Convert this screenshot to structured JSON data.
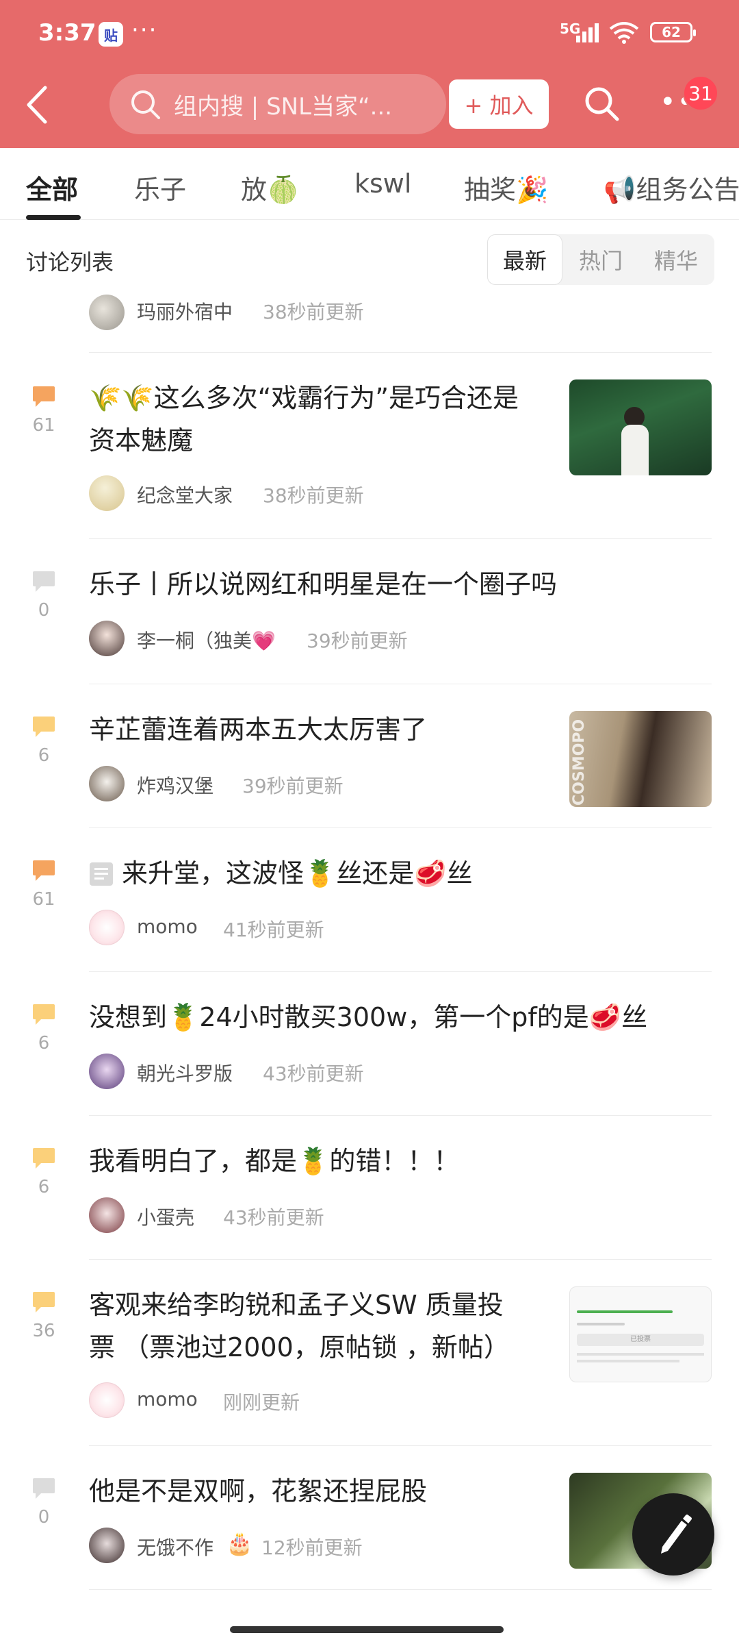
{
  "status_bar": {
    "time": "3:37",
    "app_badge": "贴",
    "more": "···",
    "network": "5G",
    "battery": "62"
  },
  "header": {
    "search_placeholder": "组内搜 | SNL当家“...",
    "join_label": "+ 加入",
    "notification_count": "31",
    "accent_color": "#e66a6a"
  },
  "tabs": [
    {
      "label": "全部"
    },
    {
      "label": "乐子"
    },
    {
      "label": "放🍈"
    },
    {
      "label": "kswl"
    },
    {
      "label": "抽奖🎉"
    },
    {
      "label": "📢组务公告"
    }
  ],
  "list": {
    "title": "讨论列表",
    "sort": [
      {
        "label": "最新"
      },
      {
        "label": "热门"
      },
      {
        "label": "精华"
      }
    ]
  },
  "partial_post": {
    "author": "玛丽外宿中",
    "updated": "38秒前更新"
  },
  "posts": [
    {
      "comments": "61",
      "title_line1": "🌾🌾这么多次“戏霸行为”是巧合还是",
      "title_line2": "资本魅魔",
      "author": "纪念堂大家",
      "updated": "38秒前更新",
      "has_thumb": true
    },
    {
      "comments": "0",
      "title_line1": "乐子丨所以说网红和明星是在一个圈子吗",
      "title_line2": "",
      "author": "李一桐（独美💗",
      "updated": "39秒前更新",
      "has_thumb": false
    },
    {
      "comments": "6",
      "title_line1": "辛芷蕾连着两本五大太厉害了",
      "title_line2": "",
      "author": "炸鸡汉堡",
      "updated": "39秒前更新",
      "has_thumb": true,
      "thumb_text": "COSMOPO"
    },
    {
      "comments": "61",
      "title_line1": "来升堂，这波怪🍍丝还是🥩丝",
      "title_line2": "",
      "author": "momo",
      "updated": "41秒前更新",
      "has_thumb": false
    },
    {
      "comments": "6",
      "title_line1": "没想到🍍24小时散买300w，第一个pf的是🥩丝",
      "title_line2": "",
      "author": "朝光斗罗版",
      "updated": "43秒前更新",
      "has_thumb": false
    },
    {
      "comments": "6",
      "title_line1": "我看明白了，都是🍍的错！！！",
      "title_line2": "",
      "author": "小蛋壳",
      "updated": "43秒前更新",
      "has_thumb": false
    },
    {
      "comments": "36",
      "title_line1": "客观来给李昀锐和孟子义SW 质量投",
      "title_line2": "票 （票池过2000，原帖锁 ，新帖）",
      "author": "momo",
      "updated": "刚刚更新",
      "has_thumb": true,
      "thumb_caption": "已投票"
    },
    {
      "comments": "0",
      "title_line1": "他是不是双啊，花絮还捏屁股",
      "title_line2": "",
      "author": "无饿不作",
      "author_badge": "🎂",
      "updated": "12秒前更新",
      "has_thumb": true
    }
  ]
}
